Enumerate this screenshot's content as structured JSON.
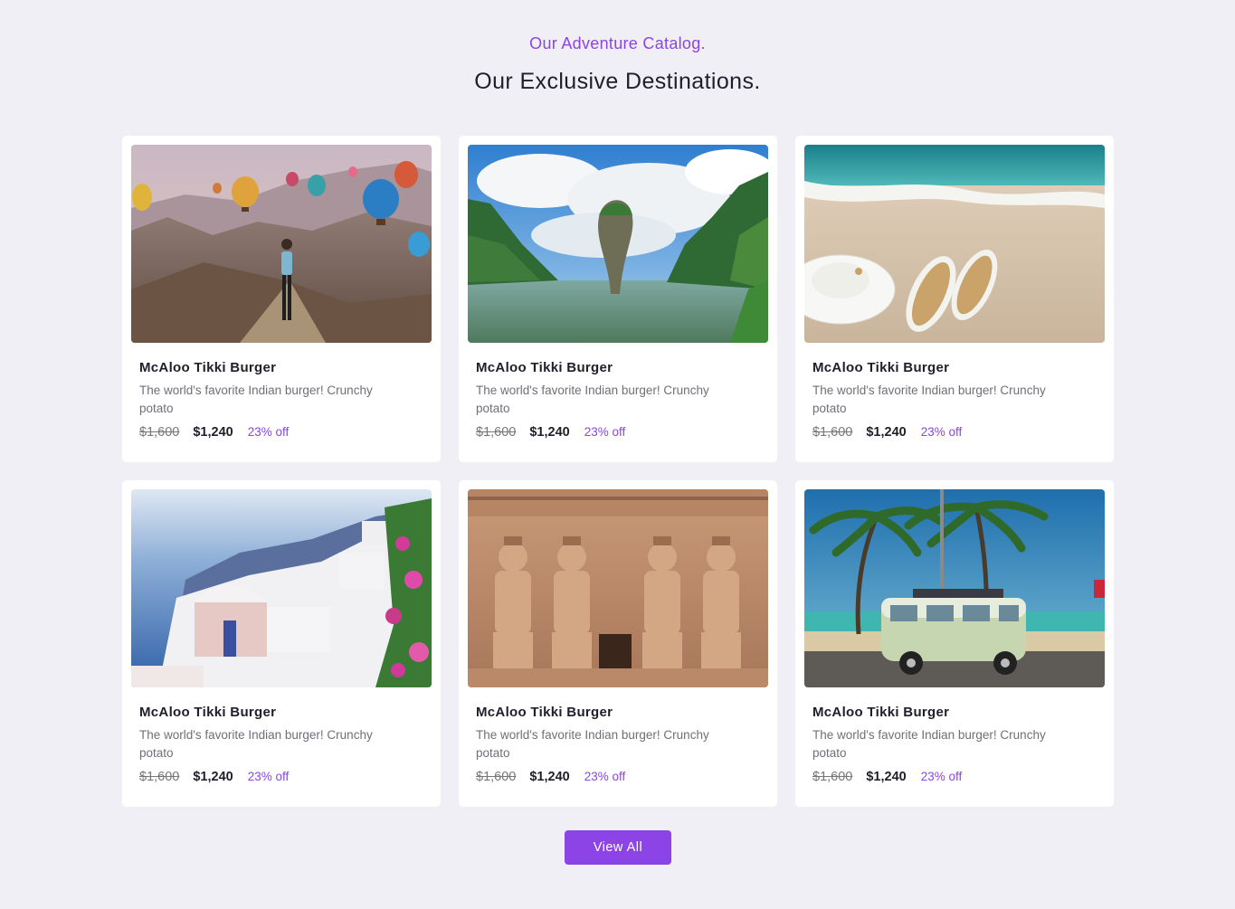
{
  "section": {
    "eyebrow": "Our Adventure Catalog.",
    "heading": "Our Exclusive Destinations."
  },
  "cards": [
    {
      "image": "cappadocia-balloons-photo",
      "title": "McAloo Tikki Burger",
      "description": "The world's favorite Indian burger! Crunchy potato",
      "old_price": "$1,600",
      "price": "$1,240",
      "discount": "23% off"
    },
    {
      "image": "phang-nga-bay-rock-photo",
      "title": "McAloo Tikki Burger",
      "description": "The world's favorite Indian burger! Crunchy potato",
      "old_price": "$1,600",
      "price": "$1,240",
      "discount": "23% off"
    },
    {
      "image": "beach-hat-sandals-photo",
      "title": "McAloo Tikki Burger",
      "description": "The world's favorite Indian burger! Crunchy potato",
      "old_price": "$1,600",
      "price": "$1,240",
      "discount": "23% off"
    },
    {
      "image": "santorini-coast-photo",
      "title": "McAloo Tikki Burger",
      "description": "The world's favorite Indian burger! Crunchy potato",
      "old_price": "$1,600",
      "price": "$1,240",
      "discount": "23% off"
    },
    {
      "image": "abu-simbel-temple-photo",
      "title": "McAloo Tikki Burger",
      "description": "The world's favorite Indian burger! Crunchy potato",
      "old_price": "$1,600",
      "price": "$1,240",
      "discount": "23% off"
    },
    {
      "image": "palm-beach-van-photo",
      "title": "McAloo Tikki Burger",
      "description": "The world's favorite Indian burger! Crunchy potato",
      "old_price": "$1,600",
      "price": "$1,240",
      "discount": "23% off"
    }
  ],
  "view_all_label": "View All",
  "colors": {
    "accent": "#8c44e6",
    "background": "#f0eff5",
    "card": "#ffffff",
    "heading_text": "#1f1f2b",
    "muted_text": "#6f6f78"
  }
}
